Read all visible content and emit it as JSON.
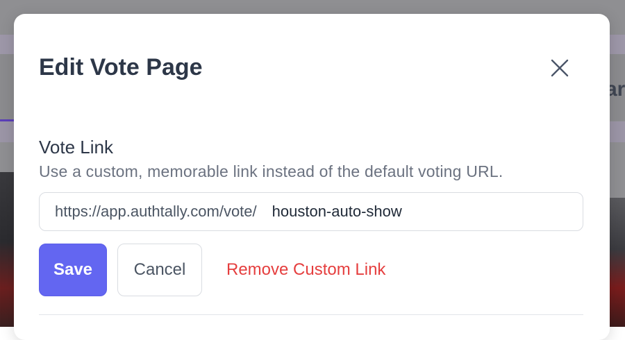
{
  "modal": {
    "title": "Edit Vote Page"
  },
  "vote_link": {
    "label": "Vote Link",
    "help_text": "Use a custom, memorable link instead of the default voting URL.",
    "prefix": "https://app.authtally.com/vote/",
    "slug_value": "houston-auto-show"
  },
  "actions": {
    "save_label": "Save",
    "cancel_label": "Cancel",
    "remove_label": "Remove Custom Link"
  },
  "colors": {
    "primary": "#6366f1",
    "danger": "#e53e3e",
    "heading": "#2d3748",
    "muted": "#6b7280"
  },
  "icons": {
    "close": "close-icon"
  }
}
